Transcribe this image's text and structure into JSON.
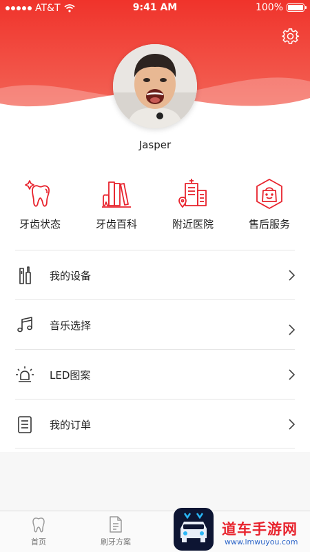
{
  "status_bar": {
    "carrier": "AT&T",
    "time": "9:41 AM",
    "battery": "100%"
  },
  "profile": {
    "name": "Jasper"
  },
  "colors": {
    "accent": "#e8232d",
    "header_top": "#f0332b",
    "header_bottom": "#f36a5b"
  },
  "quick_actions": [
    {
      "label": "牙齿状态",
      "icon": "tooth-icon"
    },
    {
      "label": "牙齿百科",
      "icon": "books-icon"
    },
    {
      "label": "附近医院",
      "icon": "hospital-icon"
    },
    {
      "label": "售后服务",
      "icon": "service-bag-icon"
    }
  ],
  "menu": [
    {
      "label": "我的设备",
      "icon": "toothbrush-device-icon"
    },
    {
      "label": "音乐选择",
      "icon": "music-note-icon"
    },
    {
      "label": "LED图案",
      "icon": "led-bulb-icon"
    },
    {
      "label": "我的订单",
      "icon": "order-list-icon"
    }
  ],
  "tabbar": [
    {
      "label": "首页",
      "icon": "tooth-home-icon"
    },
    {
      "label": "刷牙方案",
      "icon": "document-icon"
    }
  ],
  "watermark": {
    "text": "道车手游网",
    "url": "www.lmwuyou.com"
  }
}
